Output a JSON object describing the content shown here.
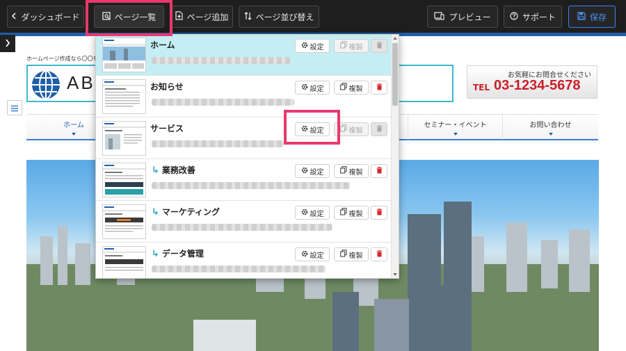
{
  "toolbar": {
    "dashboard_label": "ダッシュボード",
    "page_list_label": "ページ一覧",
    "add_page_label": "ページ追加",
    "reorder_label": "ページ並び替え",
    "preview_label": "プレビュー",
    "support_label": "サポート",
    "save_label": "保存"
  },
  "site": {
    "tagline": "ホームページ作成なら〇〇を",
    "logo_text": "AB",
    "contact_label": "お気軽にお問合せください",
    "tel_prefix": "TEL",
    "tel_number": "03-1234-5678",
    "nav": [
      {
        "label": "ホーム"
      },
      {
        "label": "セミナー・イベント"
      },
      {
        "label": "お問い合わせ"
      }
    ]
  },
  "page_list": {
    "settings_label": "設定",
    "duplicate_label": "複製",
    "rows": [
      {
        "title": "ホーム",
        "child": false,
        "selected": true
      },
      {
        "title": "お知らせ",
        "child": false,
        "selected": false
      },
      {
        "title": "サービス",
        "child": false,
        "selected": false
      },
      {
        "title": "業務改善",
        "child": true,
        "selected": false
      },
      {
        "title": "マーケティング",
        "child": true,
        "selected": false
      },
      {
        "title": "データ管理",
        "child": true,
        "selected": false
      }
    ]
  },
  "colors": {
    "toolbar_bg": "#1e1e1e",
    "accent_blue": "#1f5fa8",
    "highlight_pink": "#e8396f",
    "selected_row": "#c4eef3",
    "tel_red": "#c8202a",
    "delete_red": "#d9252b"
  }
}
